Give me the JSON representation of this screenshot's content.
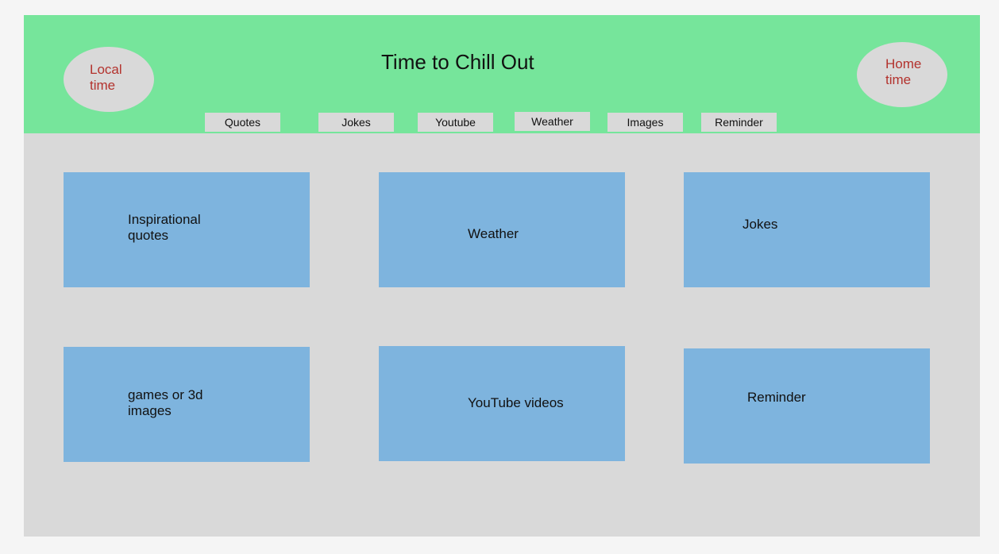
{
  "header": {
    "title": "Time to Chill Out",
    "local_time": [
      "Local",
      "time"
    ],
    "home_time": [
      "Home",
      "time"
    ],
    "accent_color": "#76e59b",
    "clock_text_color": "#b3322d"
  },
  "nav": [
    {
      "label": "Quotes"
    },
    {
      "label": "Jokes"
    },
    {
      "label": "Youtube"
    },
    {
      "label": "Weather"
    },
    {
      "label": "Images"
    },
    {
      "label": "Reminder"
    }
  ],
  "cards": [
    {
      "label": "Inspirational\nquotes"
    },
    {
      "label": "Weather"
    },
    {
      "label": "Jokes"
    },
    {
      "label": "games or 3d\nimages"
    },
    {
      "label": "YouTube  videos"
    },
    {
      "label": "Reminder"
    }
  ],
  "colors": {
    "page_background": "#d9d9d9",
    "card": "#7eb4de"
  }
}
